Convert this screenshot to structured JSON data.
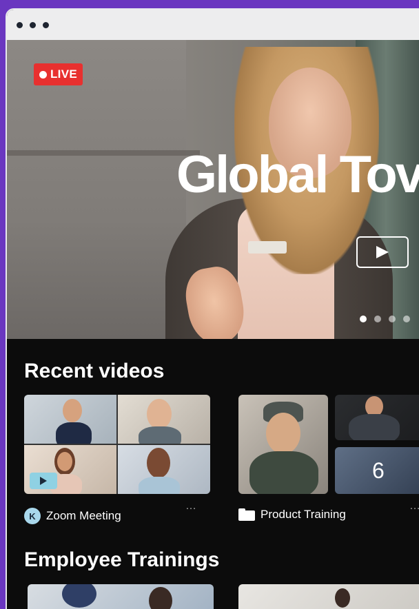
{
  "window": {
    "controls": [
      "dot",
      "dot",
      "dot"
    ]
  },
  "hero": {
    "live_label": "LIVE",
    "title": "Global Tov",
    "carousel": {
      "count": 4,
      "active": 0
    }
  },
  "recent": {
    "title": "Recent videos",
    "cards": [
      {
        "label": "Zoom Meeting",
        "avatar_letter": "K",
        "more": "…"
      },
      {
        "label": "Product Training",
        "count": "6",
        "more": "…"
      }
    ]
  },
  "trainings": {
    "title": "Employee Trainings"
  },
  "colors": {
    "accent_live": "#e8302f",
    "avatar": "#a9d8ec",
    "frame": "#6a36c0"
  },
  "icons": [
    "play-icon",
    "folder-icon",
    "more-icon",
    "live-dot-icon"
  ]
}
